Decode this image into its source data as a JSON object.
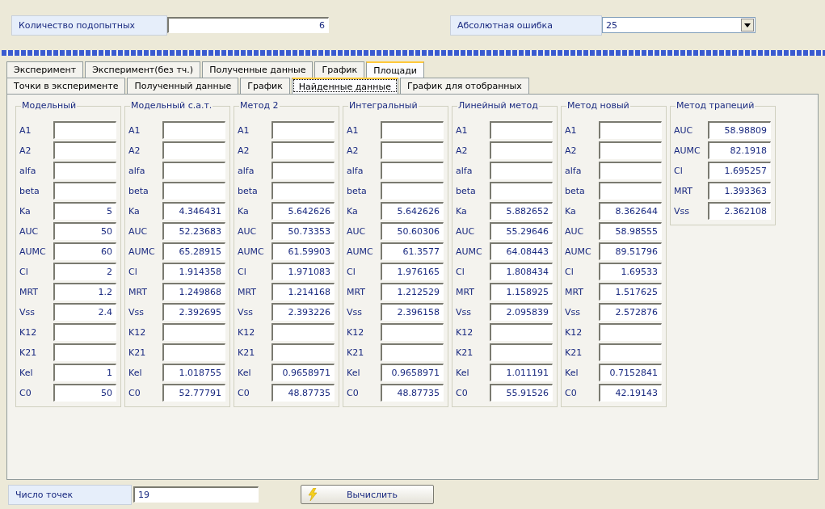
{
  "header": {
    "subjects": {
      "label": "Количество подопытных",
      "value": "6"
    },
    "abs_error": {
      "label": "Абсолютная ошибка",
      "value": "25"
    }
  },
  "progress": {
    "level": 1
  },
  "tabs": [
    {
      "label": "Эксперимент",
      "selected": false
    },
    {
      "label": "Эксперимент(без тч.)",
      "selected": false
    },
    {
      "label": "Полученные данные",
      "selected": false
    },
    {
      "label": "График",
      "selected": false
    },
    {
      "label": "Площади",
      "selected": true
    }
  ],
  "subtabs": [
    {
      "label": "Точки в эксперименте",
      "selected": false
    },
    {
      "label": "Полученный данные",
      "selected": false
    },
    {
      "label": "График",
      "selected": false
    },
    {
      "label": "Найденные данные",
      "selected": true
    },
    {
      "label": "График для отобранных",
      "selected": false
    }
  ],
  "groups": [
    {
      "title": "Модельный",
      "rows": [
        {
          "label": "A1",
          "value": ""
        },
        {
          "label": "A2",
          "value": ""
        },
        {
          "label": "alfa",
          "value": ""
        },
        {
          "label": "beta",
          "value": ""
        },
        {
          "label": "Ka",
          "value": "5"
        },
        {
          "label": "AUC",
          "value": "50"
        },
        {
          "label": "AUMC",
          "value": "60"
        },
        {
          "label": "Cl",
          "value": "2"
        },
        {
          "label": "MRT",
          "value": "1.2"
        },
        {
          "label": "Vss",
          "value": "2.4"
        },
        {
          "label": "K12",
          "value": ""
        },
        {
          "label": "K21",
          "value": ""
        },
        {
          "label": "Kel",
          "value": "1"
        },
        {
          "label": "C0",
          "value": "50"
        }
      ]
    },
    {
      "title": "Модельный с.а.т.",
      "rows": [
        {
          "label": "A1",
          "value": ""
        },
        {
          "label": "A2",
          "value": ""
        },
        {
          "label": "alfa",
          "value": ""
        },
        {
          "label": "beta",
          "value": ""
        },
        {
          "label": "Ka",
          "value": "4.346431"
        },
        {
          "label": "AUC",
          "value": "52.23683"
        },
        {
          "label": "AUMC",
          "value": "65.28915"
        },
        {
          "label": "Cl",
          "value": "1.914358"
        },
        {
          "label": "MRT",
          "value": "1.249868"
        },
        {
          "label": "Vss",
          "value": "2.392695"
        },
        {
          "label": "K12",
          "value": ""
        },
        {
          "label": "K21",
          "value": ""
        },
        {
          "label": "Kel",
          "value": "1.018755"
        },
        {
          "label": "C0",
          "value": "52.77791"
        }
      ]
    },
    {
      "title": "Метод 2",
      "rows": [
        {
          "label": "A1",
          "value": ""
        },
        {
          "label": "A2",
          "value": ""
        },
        {
          "label": "alfa",
          "value": ""
        },
        {
          "label": "beta",
          "value": ""
        },
        {
          "label": "Ka",
          "value": "5.642626"
        },
        {
          "label": "AUC",
          "value": "50.73353"
        },
        {
          "label": "AUMC",
          "value": "61.59903"
        },
        {
          "label": "Cl",
          "value": "1.971083"
        },
        {
          "label": "MRT",
          "value": "1.214168"
        },
        {
          "label": "Vss",
          "value": "2.393226"
        },
        {
          "label": "K12",
          "value": ""
        },
        {
          "label": "K21",
          "value": ""
        },
        {
          "label": "Kel",
          "value": "0.9658971"
        },
        {
          "label": "C0",
          "value": "48.87735"
        }
      ]
    },
    {
      "title": "Интегральный",
      "rows": [
        {
          "label": "A1",
          "value": ""
        },
        {
          "label": "A2",
          "value": ""
        },
        {
          "label": "alfa",
          "value": ""
        },
        {
          "label": "beta",
          "value": ""
        },
        {
          "label": "Ka",
          "value": "5.642626"
        },
        {
          "label": "AUC",
          "value": "50.60306"
        },
        {
          "label": "AUMC",
          "value": "61.3577"
        },
        {
          "label": "Cl",
          "value": "1.976165"
        },
        {
          "label": "MRT",
          "value": "1.212529"
        },
        {
          "label": "Vss",
          "value": "2.396158"
        },
        {
          "label": "K12",
          "value": ""
        },
        {
          "label": "K21",
          "value": ""
        },
        {
          "label": "Kel",
          "value": "0.9658971"
        },
        {
          "label": "C0",
          "value": "48.87735"
        }
      ]
    },
    {
      "title": "Линейный метод",
      "rows": [
        {
          "label": "A1",
          "value": ""
        },
        {
          "label": "A2",
          "value": ""
        },
        {
          "label": "alfa",
          "value": ""
        },
        {
          "label": "beta",
          "value": ""
        },
        {
          "label": "Ka",
          "value": "5.882652"
        },
        {
          "label": "AUC",
          "value": "55.29646"
        },
        {
          "label": "AUMC",
          "value": "64.08443"
        },
        {
          "label": "Cl",
          "value": "1.808434"
        },
        {
          "label": "MRT",
          "value": "1.158925"
        },
        {
          "label": "Vss",
          "value": "2.095839"
        },
        {
          "label": "K12",
          "value": ""
        },
        {
          "label": "K21",
          "value": ""
        },
        {
          "label": "Kel",
          "value": "1.011191"
        },
        {
          "label": "C0",
          "value": "55.91526"
        }
      ]
    },
    {
      "title": "Метод новый",
      "rows": [
        {
          "label": "A1",
          "value": ""
        },
        {
          "label": "A2",
          "value": ""
        },
        {
          "label": "alfa",
          "value": ""
        },
        {
          "label": "beta",
          "value": ""
        },
        {
          "label": "Ka",
          "value": "8.362644"
        },
        {
          "label": "AUC",
          "value": "58.98555"
        },
        {
          "label": "AUMC",
          "value": "89.51796"
        },
        {
          "label": "Cl",
          "value": "1.69533"
        },
        {
          "label": "MRT",
          "value": "1.517625"
        },
        {
          "label": "Vss",
          "value": "2.572876"
        },
        {
          "label": "K12",
          "value": ""
        },
        {
          "label": "K21",
          "value": ""
        },
        {
          "label": "Kel",
          "value": "0.7152841"
        },
        {
          "label": "C0",
          "value": "42.19143"
        }
      ]
    },
    {
      "title": "Метод трапеций",
      "rows": [
        {
          "label": "AUC",
          "value": "58.98809"
        },
        {
          "label": "AUMC",
          "value": "82.1918"
        },
        {
          "label": "Cl",
          "value": "1.695257"
        },
        {
          "label": "MRT",
          "value": "1.393363"
        },
        {
          "label": "Vss",
          "value": "2.362108"
        }
      ]
    }
  ],
  "footer": {
    "points": {
      "label": "Число точек",
      "value": "19"
    },
    "compute_button": "Вычислить"
  }
}
